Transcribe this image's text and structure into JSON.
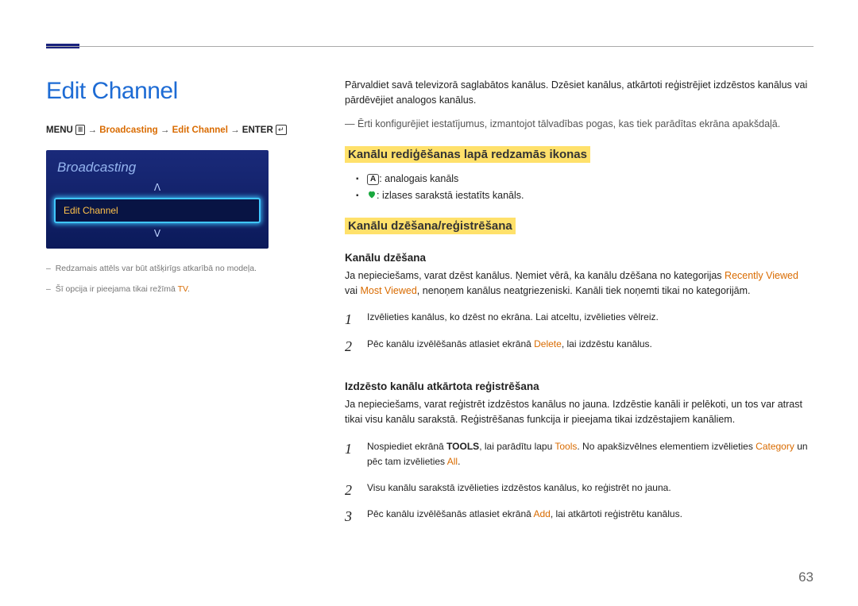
{
  "page_number": "63",
  "page_title": "Edit Channel",
  "breadcrumb": {
    "menu_label": "MENU",
    "broadcasting": "Broadcasting",
    "edit_channel": "Edit Channel",
    "enter_label": "ENTER"
  },
  "ui_panel": {
    "title": "Broadcasting",
    "item": "Edit Channel"
  },
  "footnotes": {
    "note1": "Redzamais attēls var būt atšķirīgs atkarībā no modeļa.",
    "note2_a": "Šī opcija ir pieejama tikai režīmā ",
    "note2_b": "TV",
    "note2_c": "."
  },
  "intro": "Pārvaldiet savā televizorā saglabātos kanālus. Dzēsiet kanālus, atkārtoti reģistrējiet izdzēstos kanālus vai pārdēvējiet analogos kanālus.",
  "intro_note": "Ērti konfigurējiet iestatījumus, izmantojot tālvadības pogas, kas tiek parādītas ekrāna apakšdaļā.",
  "section1": {
    "title": "Kanālu rediģēšanas lapā redzamās ikonas",
    "bullet1": ": analogais kanāls",
    "bullet2": ": izlases sarakstā iestatīts kanāls."
  },
  "section2": {
    "title": "Kanālu dzēšana/reģistrēšana",
    "sub1": {
      "title": "Kanālu dzēšana",
      "body_a": "Ja nepieciešams, varat dzēst kanālus. Ņemiet vērā, ka kanālu dzēšana no kategorijas ",
      "recently": "Recently Viewed",
      "body_b": " vai ",
      "most": "Most Viewed",
      "body_c": ", nenoņem kanālus neatgriezeniski. Kanāli tiek noņemti tikai no kategorijām.",
      "step1": "Izvēlieties kanālus, ko dzēst no ekrāna. Lai atceltu, izvēlieties vēlreiz.",
      "step2_a": "Pēc kanālu izvēlēšanās atlasiet ekrānā ",
      "step2_delete": "Delete",
      "step2_b": ", lai izdzēstu kanālus."
    },
    "sub2": {
      "title": "Izdzēsto kanālu atkārtota reģistrēšana",
      "body": "Ja nepieciešams, varat reģistrēt izdzēstos kanālus no jauna. Izdzēstie kanāli ir pelēkoti, un tos var atrast tikai visu kanālu sarakstā. Reģistrēšanas funkcija ir pieejama tikai izdzēstajiem kanāliem.",
      "step1_a": "Nospiediet ekrānā ",
      "step1_tools_b": "TOOLS",
      "step1_b": ", lai parādītu lapu ",
      "step1_tools_o": "Tools",
      "step1_c": ". No apakšizvēlnes elementiem izvēlieties ",
      "step1_cat": "Category",
      "step1_d": " un pēc tam izvēlieties ",
      "step1_all": "All",
      "step1_e": ".",
      "step2": "Visu kanālu sarakstā izvēlieties izdzēstos kanālus, ko reģistrēt no jauna.",
      "step3_a": "Pēc kanālu izvēlēšanās atlasiet ekrānā ",
      "step3_add": "Add",
      "step3_b": ", lai atkārtoti reģistrētu kanālus."
    }
  }
}
